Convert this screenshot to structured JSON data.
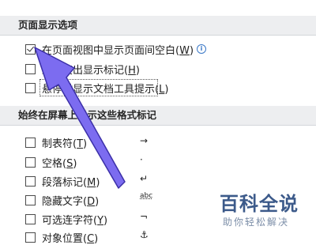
{
  "page_display": {
    "title": "页面显示选项",
    "options": [
      {
        "text": "在页面视图中显示页面间空白",
        "key": "W",
        "checked": true,
        "info": "i"
      },
      {
        "text": "显示突出显示标记",
        "key": "H",
        "checked": false
      },
      {
        "text": "悬停时显示文档工具提示",
        "key": "L",
        "checked": false
      }
    ]
  },
  "format_marks": {
    "title": "始终在屏幕上显示这些格式标记",
    "options": [
      {
        "text": "制表符",
        "key": "T",
        "mark": "→",
        "checked": false
      },
      {
        "text": "空格",
        "key": "S",
        "mark": "·",
        "checked": false
      },
      {
        "text": "段落标记",
        "key": "M",
        "mark": "↵",
        "checked": false
      },
      {
        "text": "隐藏文字",
        "key": "D",
        "mark": "abc",
        "checked": false
      },
      {
        "text": "可选连字符",
        "key": "Y",
        "mark": "¬",
        "checked": false
      },
      {
        "text": "对象位置",
        "key": "C",
        "mark": "⚓",
        "checked": false
      }
    ]
  },
  "watermark": {
    "title": "百科全说",
    "subtitle": "助你轻松解决"
  },
  "colors": {
    "arrow": "#7c6cf0",
    "arrow_stroke": "#3b2fa8",
    "header_bg": "#edeef0",
    "info": "#3a78c7"
  }
}
